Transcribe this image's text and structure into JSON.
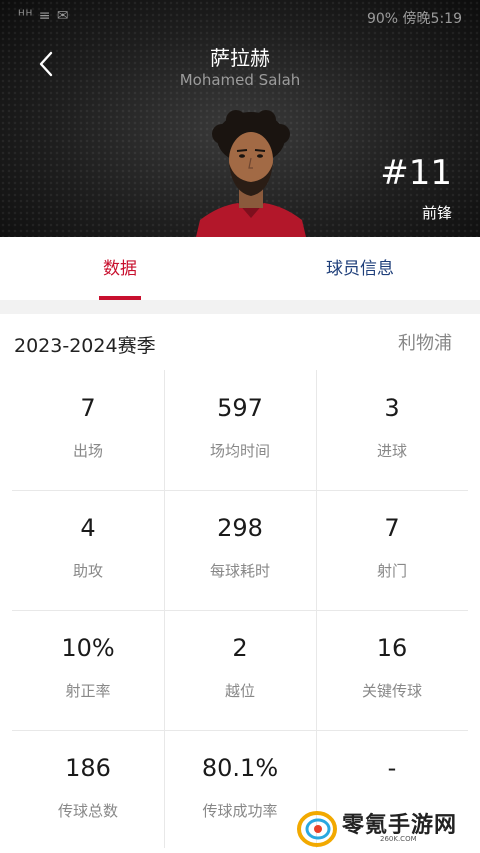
{
  "status_bar": {
    "left": "ᴴᴴ ≡ ✉",
    "right": "90%  傍晚5:19"
  },
  "header": {
    "name_cn": "萨拉赫",
    "name_en": "Mohamed Salah",
    "number": "#11",
    "position": "前锋"
  },
  "tabs": [
    {
      "label": "数据",
      "active": true
    },
    {
      "label": "球员信息",
      "active": false
    }
  ],
  "season": {
    "label": "2023-2024赛季",
    "team": "利物浦"
  },
  "stats": [
    {
      "value": "7",
      "label": "出场"
    },
    {
      "value": "597",
      "label": "场均时间"
    },
    {
      "value": "3",
      "label": "进球"
    },
    {
      "value": "4",
      "label": "助攻"
    },
    {
      "value": "298",
      "label": "每球耗时"
    },
    {
      "value": "7",
      "label": "射门"
    },
    {
      "value": "10%",
      "label": "射正率"
    },
    {
      "value": "2",
      "label": "越位"
    },
    {
      "value": "16",
      "label": "关键传球"
    },
    {
      "value": "186",
      "label": "传球总数"
    },
    {
      "value": "80.1%",
      "label": "传球成功率"
    },
    {
      "value": "-",
      "label": ""
    }
  ],
  "watermark": {
    "text": "零氪手游网",
    "url": "260K.COM"
  },
  "colors": {
    "accent": "#c8102e",
    "info_tab": "#1f3f7a",
    "header_bg": "#1e1e1e"
  }
}
